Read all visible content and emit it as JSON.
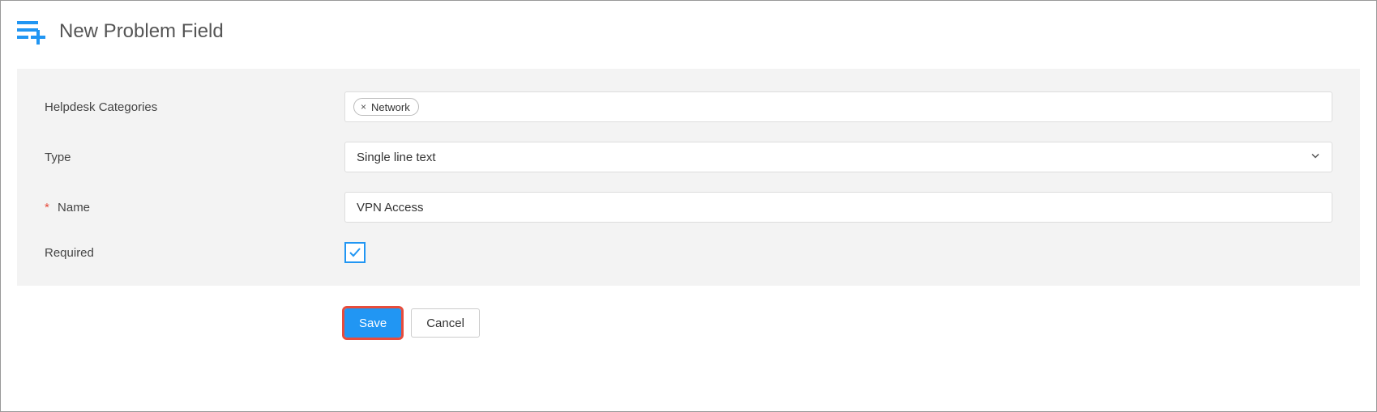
{
  "header": {
    "title": "New Problem Field"
  },
  "form": {
    "categories": {
      "label": "Helpdesk Categories",
      "tags": [
        {
          "label": "Network"
        }
      ]
    },
    "type": {
      "label": "Type",
      "value": "Single line text"
    },
    "name": {
      "label": "Name",
      "required": true,
      "value": "VPN Access"
    },
    "required": {
      "label": "Required",
      "checked": true
    }
  },
  "actions": {
    "save": "Save",
    "cancel": "Cancel"
  },
  "colors": {
    "accent": "#2196f3",
    "highlight": "#e74c3c"
  }
}
